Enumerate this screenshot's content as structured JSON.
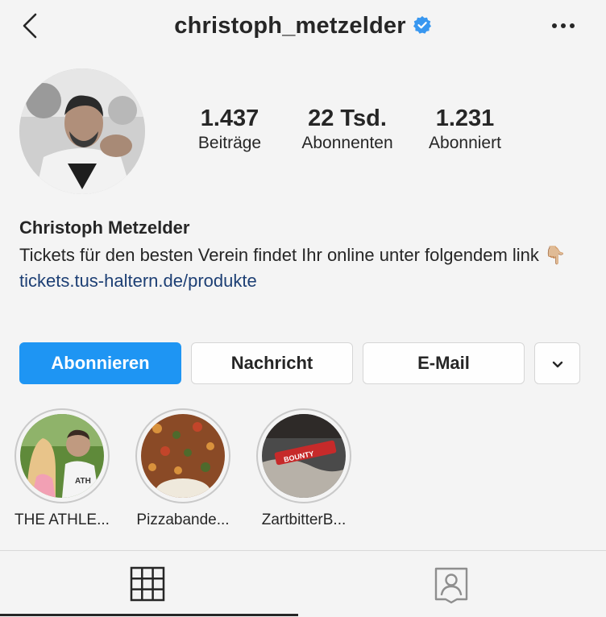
{
  "header": {
    "username": "christoph_metzelder",
    "back_icon": "chevron-left-icon",
    "verified_icon": "verified-badge-icon",
    "more_icon": "more-horizontal-icon",
    "verified_color": "#3897f0"
  },
  "stats": {
    "posts": {
      "value": "1.437",
      "label": "Beiträge"
    },
    "followers": {
      "value": "22 Tsd.",
      "label": "Abonnenten"
    },
    "following": {
      "value": "1.231",
      "label": "Abonniert"
    }
  },
  "bio": {
    "name": "Christoph Metzelder",
    "text": "Tickets für den besten Verein findet Ihr online unter folgendem link 👇🏼",
    "link": "tickets.tus-haltern.de/produkte",
    "link_color": "#1d3f74"
  },
  "actions": {
    "follow": "Abonnieren",
    "message": "Nachricht",
    "email": "E-Mail",
    "more_icon": "chevron-down-icon",
    "accent_color": "#1e95f3"
  },
  "highlights": [
    {
      "label": "THE ATHLE..."
    },
    {
      "label": "Pizzabande..."
    },
    {
      "label": "ZartbitterB..."
    }
  ],
  "tabs": {
    "grid_icon": "grid-icon",
    "tagged_icon": "tagged-person-icon"
  }
}
